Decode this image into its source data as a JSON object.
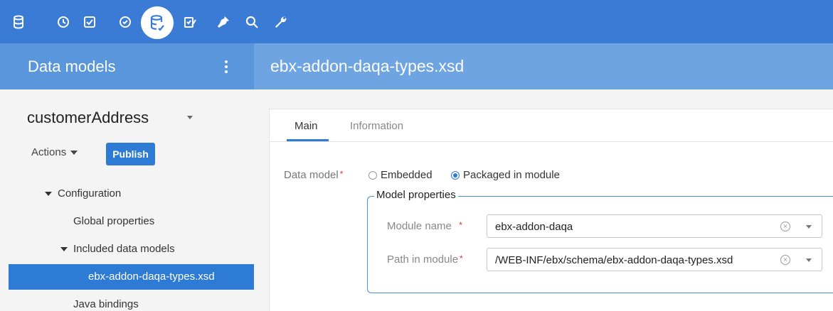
{
  "topbar": {
    "icons": [
      "database-icon",
      "clock-icon",
      "checkbox-icon",
      "check-circle-icon",
      "data-models-icon",
      "edit-check-icon",
      "plug-icon",
      "search-icon",
      "wrench-icon"
    ],
    "active_icon": "data-models-icon",
    "accent": "#3a7bd5"
  },
  "header": {
    "section_title": "Data models",
    "document_title": "ebx-addon-daqa-types.xsd"
  },
  "sidebar": {
    "model_name": "customerAddress",
    "actions_label": "Actions",
    "publish_label": "Publish",
    "tree": {
      "configuration": "Configuration",
      "global_properties": "Global properties",
      "included_data_models": "Included data models",
      "selected_item": "ebx-addon-daqa-types.xsd",
      "java_bindings": "Java bindings"
    }
  },
  "main": {
    "tabs": [
      {
        "label": "Main",
        "active": true
      },
      {
        "label": "Information",
        "active": false
      }
    ],
    "data_model_label": "Data model",
    "radio_embedded": "Embedded",
    "radio_packaged": "Packaged in module",
    "selected_option": "Packaged in module",
    "model_properties_legend": "Model properties",
    "module_name_label": "Module name",
    "module_name_value": "ebx-addon-daqa",
    "path_label": "Path in module",
    "path_value": "/WEB-INF/ebx/schema/ebx-addon-daqa-types.xsd",
    "required_mark": "*"
  }
}
